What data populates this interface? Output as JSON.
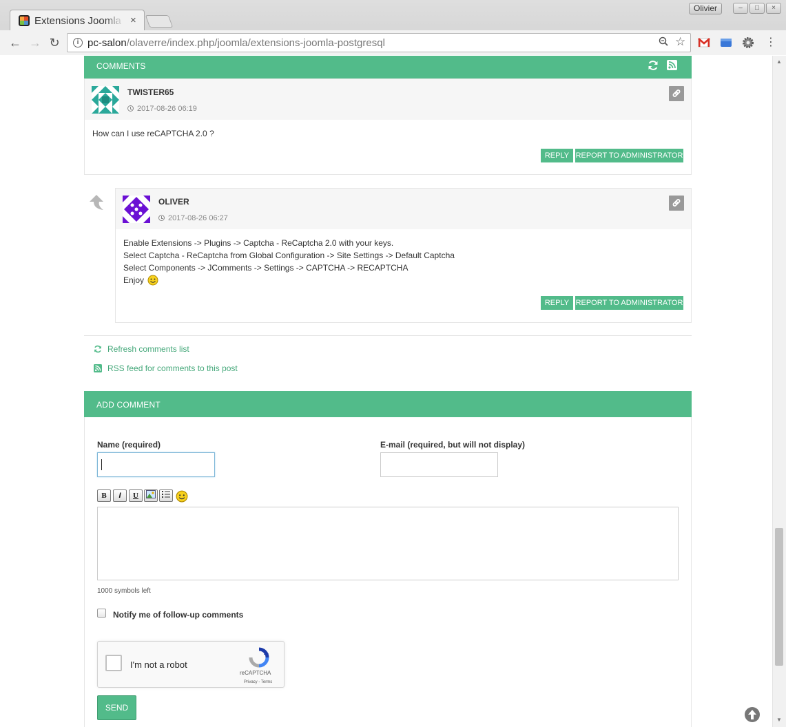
{
  "browser": {
    "tab_title": "Extensions Joomla PostgreSQL",
    "tab_close": "×",
    "user_badge": "Olivier",
    "url_host": "pc-salon",
    "url_path": "/olaverre/index.php/joomla/extensions-joomla-postgresql"
  },
  "comments_header": {
    "title": "COMMENTS"
  },
  "comments": [
    {
      "author": "TWISTER65",
      "date": "2017-08-26 06:19",
      "body": [
        "How can I use reCAPTCHA 2.0 ?"
      ],
      "reply_label": "REPLY",
      "report_label": "REPORT TO ADMINISTRATOR",
      "avatar_color": "#2aa89a"
    },
    {
      "author": "OLIVER",
      "date": "2017-08-26 06:27",
      "body": [
        "Enable Extensions -> Plugins -> Captcha - ReCaptcha 2.0 with your keys.",
        "Select Captcha - ReCaptcha from Global Configuration -> Site Settings -> Default Captcha",
        "Select Components -> JComments -> Settings -> CAPTCHA -> RECAPTCHA",
        "Enjoy"
      ],
      "reply_label": "REPLY",
      "report_label": "REPORT TO ADMINISTRATOR",
      "avatar_color": "#6b10d4"
    }
  ],
  "links": {
    "refresh": "Refresh comments list",
    "rss": "RSS feed for comments to this post"
  },
  "add_comment": {
    "title": "ADD COMMENT",
    "name_label": "Name (required)",
    "name_value": "",
    "email_label": "E-mail (required, but will not display)",
    "email_value": "",
    "symbols_left": "1000 symbols left",
    "notify_label": "Notify me of follow-up comments",
    "send_label": "SEND"
  },
  "bbcode_buttons": [
    "B",
    "I",
    "U",
    "img",
    "list",
    "smile"
  ],
  "recaptcha": {
    "label": "I'm not a robot",
    "brand": "reCAPTCHA",
    "terms": "Privacy - Terms"
  },
  "colors": {
    "accent": "#52bb8a",
    "link": "#45a87a"
  }
}
